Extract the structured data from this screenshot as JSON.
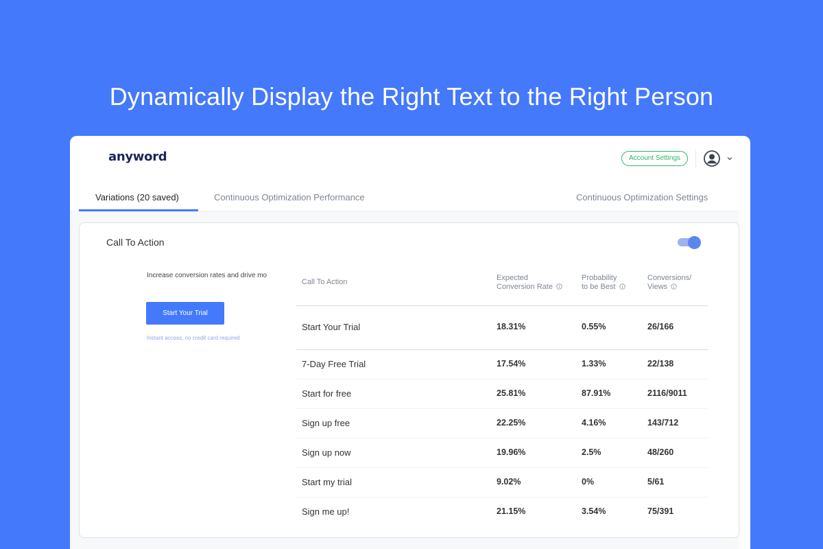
{
  "headline": "Dynamically Display the Right Text to the Right Person",
  "app": {
    "logo": "anyword",
    "account_settings_label": "Account Settings"
  },
  "tabs": [
    {
      "label": "Variations (20 saved)",
      "active": true
    },
    {
      "label": "Continuous Optimization Performance",
      "active": false
    },
    {
      "label": "Continuous Optimization Settings",
      "active": false
    }
  ],
  "card": {
    "title": "Call To Action",
    "toggle_on": true,
    "preview": {
      "text": "Increase conversion rates and drive mo",
      "button_label": "Start Your Trial",
      "subtext": "Instant access, no credit card required"
    }
  },
  "table": {
    "headers": {
      "cta": "Call To Action",
      "ecr_line1": "Expected",
      "ecr_line2": "Conversion Rate",
      "ptb_line1": "Probability",
      "ptb_line2": "to be Best",
      "cv_line1": "Conversions/",
      "cv_line2": "Views"
    },
    "rows": [
      {
        "cta": "Start Your Trial",
        "ecr": "18.31%",
        "ptb": "0.55%",
        "cv": "26/166"
      },
      {
        "cta": "7-Day Free Trial",
        "ecr": "17.54%",
        "ptb": "1.33%",
        "cv": "22/138"
      },
      {
        "cta": "Start for free",
        "ecr": "25.81%",
        "ptb": "87.91%",
        "cv": "2116/9011"
      },
      {
        "cta": "Sign up free",
        "ecr": "22.25%",
        "ptb": "4.16%",
        "cv": "143/712"
      },
      {
        "cta": "Sign up now",
        "ecr": "19.96%",
        "ptb": "2.5%",
        "cv": "48/260"
      },
      {
        "cta": "Start my trial",
        "ecr": "9.02%",
        "ptb": "0%",
        "cv": "5/61"
      },
      {
        "cta": "Sign me up!",
        "ecr": "21.15%",
        "ptb": "3.54%",
        "cv": "75/391"
      }
    ]
  },
  "colors": {
    "background": "#4479FC",
    "accent": "#4479FC",
    "success": "#2FB36A",
    "logo": "#1B2559"
  },
  "icons": [
    "user-avatar-icon",
    "chevron-down-icon",
    "info-icon"
  ]
}
